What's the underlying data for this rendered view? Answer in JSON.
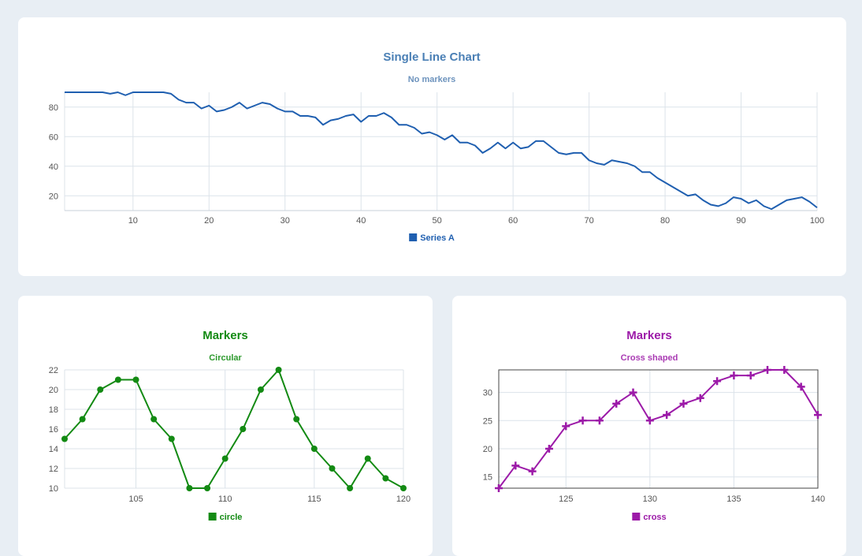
{
  "chart_data": [
    {
      "id": "top",
      "type": "line",
      "title": "Single Line Chart",
      "subtitle": "No markers",
      "color": "#1f5fb0",
      "title_color": "#4a7fb5",
      "subtitle_color": "#6d93bd",
      "xlim": [
        1,
        100
      ],
      "ylim": [
        10,
        90
      ],
      "x_ticks": [
        10,
        20,
        30,
        40,
        50,
        60,
        70,
        80,
        90,
        100
      ],
      "y_ticks": [
        20,
        40,
        60,
        80
      ],
      "grid": true,
      "marker": "none",
      "legend_position": "bottom-center",
      "series": [
        {
          "name": "Series A",
          "x": [
            1,
            2,
            3,
            4,
            5,
            6,
            7,
            8,
            9,
            10,
            11,
            12,
            13,
            14,
            15,
            16,
            17,
            18,
            19,
            20,
            21,
            22,
            23,
            24,
            25,
            26,
            27,
            28,
            29,
            30,
            31,
            32,
            33,
            34,
            35,
            36,
            37,
            38,
            39,
            40,
            41,
            42,
            43,
            44,
            45,
            46,
            47,
            48,
            49,
            50,
            51,
            52,
            53,
            54,
            55,
            56,
            57,
            58,
            59,
            60,
            61,
            62,
            63,
            64,
            65,
            66,
            67,
            68,
            69,
            70,
            71,
            72,
            73,
            74,
            75,
            76,
            77,
            78,
            79,
            80,
            81,
            82,
            83,
            84,
            85,
            86,
            87,
            88,
            89,
            90,
            91,
            92,
            93,
            94,
            95,
            96,
            97,
            98,
            99,
            100
          ],
          "values": [
            90,
            90,
            90,
            90,
            90,
            90,
            89,
            90,
            88,
            90,
            90,
            90,
            90,
            90,
            89,
            85,
            83,
            83,
            79,
            81,
            77,
            78,
            80,
            83,
            79,
            81,
            83,
            82,
            79,
            77,
            77,
            74,
            74,
            73,
            68,
            71,
            72,
            74,
            75,
            70,
            74,
            74,
            76,
            73,
            68,
            68,
            66,
            62,
            63,
            61,
            58,
            61,
            56,
            56,
            54,
            49,
            52,
            56,
            52,
            56,
            52,
            53,
            57,
            57,
            53,
            49,
            48,
            49,
            49,
            44,
            42,
            41,
            44,
            43,
            42,
            40,
            36,
            36,
            32,
            29,
            26,
            23,
            20,
            21,
            17,
            14,
            13,
            15,
            19,
            18,
            15,
            17,
            13,
            11,
            14,
            17,
            18,
            19,
            16,
            12
          ]
        }
      ]
    },
    {
      "id": "left",
      "type": "line",
      "title": "Markers",
      "subtitle": "Circular",
      "color": "#138a13",
      "title_color": "#138a13",
      "subtitle_color": "#2e9a2e",
      "xlim": [
        101,
        120
      ],
      "ylim": [
        10,
        22
      ],
      "x_ticks": [
        105,
        110,
        115,
        120
      ],
      "y_ticks": [
        10,
        12,
        14,
        16,
        18,
        20,
        22
      ],
      "grid": true,
      "marker": "circle",
      "legend_position": "bottom-center",
      "series": [
        {
          "name": "circle",
          "x": [
            101,
            102,
            103,
            104,
            105,
            106,
            107,
            108,
            109,
            110,
            111,
            112,
            113,
            114,
            115,
            116,
            117,
            118,
            119,
            120
          ],
          "values": [
            15,
            17,
            20,
            21,
            21,
            17,
            15,
            10,
            10,
            13,
            16,
            20,
            22,
            17,
            14,
            12,
            10,
            13,
            11,
            10
          ]
        }
      ]
    },
    {
      "id": "right",
      "type": "line",
      "title": "Markers",
      "subtitle": "Cross shaped",
      "color": "#9c1aa8",
      "title_color": "#9c1aa8",
      "subtitle_color": "#a93ab3",
      "xlim": [
        121,
        140
      ],
      "ylim": [
        13,
        34
      ],
      "x_ticks": [
        125,
        130,
        135,
        140
      ],
      "y_ticks": [
        15,
        20,
        25,
        30
      ],
      "grid": true,
      "marker": "cross",
      "legend_position": "bottom-center",
      "series": [
        {
          "name": "cross",
          "x": [
            121,
            122,
            123,
            124,
            125,
            126,
            127,
            128,
            129,
            130,
            131,
            132,
            133,
            134,
            135,
            136,
            137,
            138,
            139,
            140
          ],
          "values": [
            13,
            17,
            16,
            20,
            24,
            25,
            25,
            28,
            30,
            25,
            26,
            28,
            29,
            32,
            33,
            33,
            34,
            34,
            31,
            26
          ]
        }
      ]
    }
  ]
}
